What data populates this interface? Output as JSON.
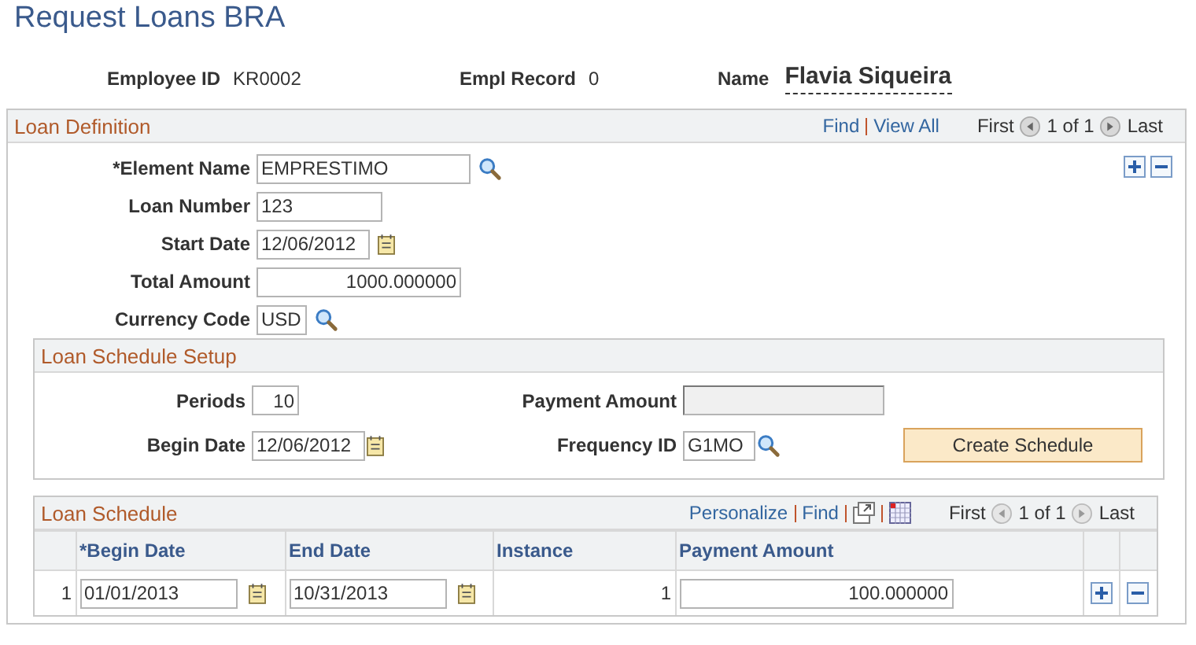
{
  "title": "Request Loans BRA",
  "header": [
    {
      "label": "Employee ID",
      "value": "KR0002",
      "kind": "plain"
    },
    {
      "label": "Empl Record",
      "value": "0",
      "kind": "plain"
    },
    {
      "label": "Name",
      "value": "Flavia Siqueira",
      "kind": "name"
    }
  ],
  "loan_definition": {
    "title": "Loan Definition",
    "links": [
      "Find",
      "View All"
    ],
    "nav": {
      "first": "First",
      "count": "1 of 1",
      "last": "Last"
    },
    "fields": [
      {
        "label": "*Element Name",
        "value": "EMPRESTIMO",
        "kind": "lookup"
      },
      {
        "label": "Loan Number",
        "value": "123",
        "kind": "text"
      },
      {
        "label": "Start Date",
        "value": "12/06/2012",
        "kind": "date"
      },
      {
        "label": "Total Amount",
        "value": "1000.000000",
        "kind": "number"
      },
      {
        "label": "Currency Code",
        "value": "USD",
        "kind": "lookup"
      }
    ]
  },
  "schedule_setup": {
    "title": "Loan Schedule Setup",
    "fields": [
      {
        "label": "Periods",
        "value": "10",
        "kind": "number",
        "disabled": false
      },
      {
        "label": "Payment Amount",
        "kind": "text",
        "disabled": true
      },
      {
        "label": "Begin Date",
        "value": "12/06/2012",
        "kind": "date",
        "disabled": false
      },
      {
        "label": "Frequency ID",
        "value": "G1MO",
        "kind": "lookup",
        "disabled": false
      }
    ],
    "button": "Create Schedule"
  },
  "loan_schedule": {
    "title": "Loan Schedule",
    "links": [
      "Personalize",
      "Find"
    ],
    "nav": {
      "first": "First",
      "count": "1 of 1",
      "last": "Last"
    },
    "columns": [
      "*Begin Date",
      "End Date",
      "Instance",
      "Payment Amount"
    ],
    "rows": [
      {
        "number": "1",
        "begin_date": "01/01/2013",
        "end_date": "10/31/2013",
        "instance": "1",
        "payment_amount": "100.000000"
      }
    ]
  }
}
